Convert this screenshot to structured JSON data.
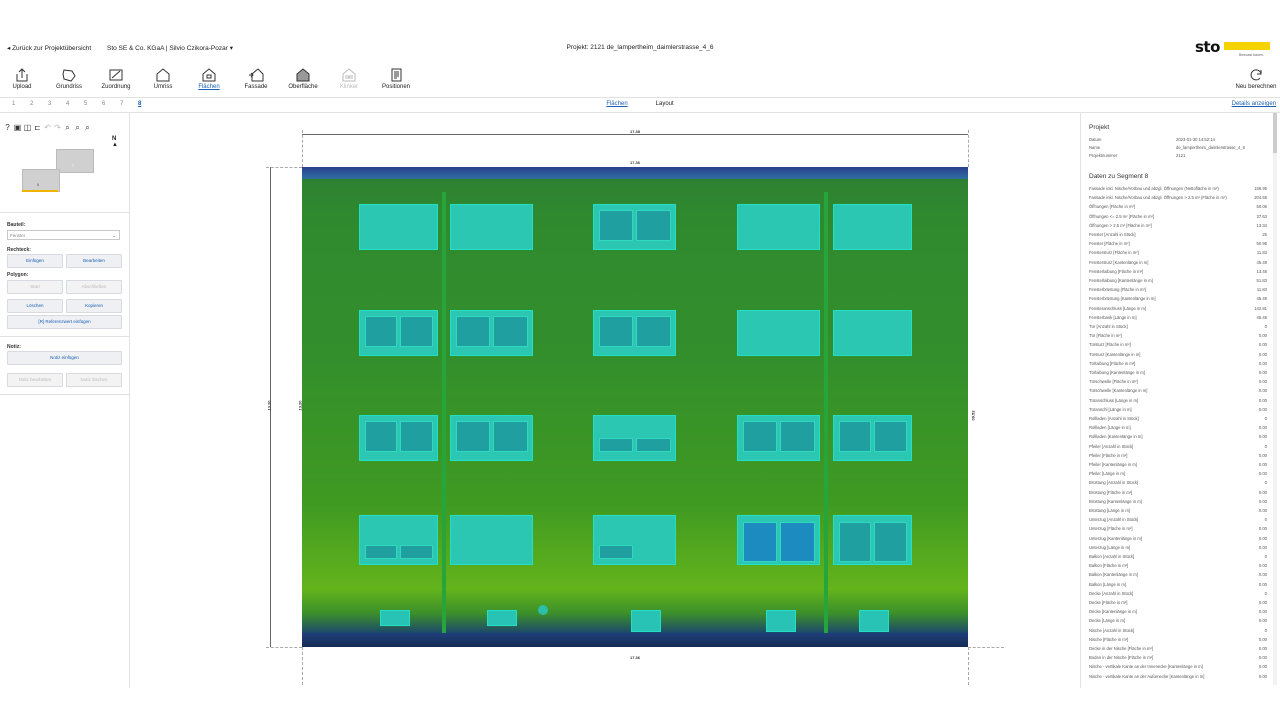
{
  "header": {
    "back_label": "Zurück zur Projektübersicht",
    "org_label": "Sto SE & Co. KGaA | Silvio Czikora-Pozar",
    "project_title": "Projekt: 2121 de_lampertheim_daimlerstrasse_4_6",
    "logo_text": "sto",
    "logo_slogan": "Bewusst bauen.",
    "brand_color": "#f5d300"
  },
  "toolbar": {
    "items": [
      {
        "label": "Upload",
        "icon": "upload-icon"
      },
      {
        "label": "Grundriss",
        "icon": "floorplan-icon"
      },
      {
        "label": "Zuordnung",
        "icon": "assign-icon"
      },
      {
        "label": "Umriss",
        "icon": "outline-icon"
      },
      {
        "label": "Flächen",
        "icon": "areas-icon"
      },
      {
        "label": "Fassade",
        "icon": "facade-icon"
      },
      {
        "label": "Oberfläche",
        "icon": "surface-icon"
      },
      {
        "label": "Klinker",
        "icon": "brick-icon"
      },
      {
        "label": "Positionen",
        "icon": "positions-icon"
      }
    ],
    "recalc_label": "Neu berechnen"
  },
  "segments": [
    "1",
    "2",
    "3",
    "4",
    "5",
    "6",
    "7",
    "8"
  ],
  "active_segment": "8",
  "tabs": [
    "Flächen",
    "Layout"
  ],
  "active_tab": "Flächen",
  "details_link": "Details anzeigen",
  "left_panel": {
    "north_label": "N",
    "minimap_labels": [
      "4",
      "5",
      "7",
      "8"
    ],
    "bauteil_label": "Bauteil:",
    "bauteil_value": "Fenster",
    "rechteck_label": "Rechteck:",
    "btn_einfuegen": "Einfügen",
    "btn_bearbeiten": "Bearbeiten",
    "polygon_label": "Polygon:",
    "btn_start": "Start",
    "btn_abschliessen": "Abschließen",
    "btn_loeschen": "Löschen",
    "btn_kopieren": "Kopieren",
    "btn_referenz": "[R] Referenzwert einfügen",
    "notiz_label": "Notiz:",
    "btn_notiz_einfuegen": "Notiz einfügen",
    "btn_notiz_bearbeiten": "Notiz bearbeiten",
    "btn_notiz_loeschen": "Notiz löschen"
  },
  "drawing": {
    "dim_top": "17.38",
    "dim_top_inner": "17.36",
    "dim_bottom": "17.36",
    "dim_left": "13.20",
    "dim_left_inner": "13.20",
    "dim_right": "09.53"
  },
  "right_panel": {
    "project_heading": "Projekt",
    "project_rows": [
      {
        "k": "Datum",
        "v": "2023-01-30 14:52:14"
      },
      {
        "k": "Name",
        "v": "de_lampertheim_daimlerstrasse_4_6"
      },
      {
        "k": "Projektnummer",
        "v": "2121"
      }
    ],
    "segment_heading": "Daten zu Segment 8",
    "data_rows": [
      {
        "k": "Fassade inkl. Nische/Vorbau und abzgl. Öffnungen (Nettofläche in m²)",
        "v": "158.95"
      },
      {
        "k": "Fassade inkl. Nische/Vorbau und abzgl. Öffnungen > 2.5 m² (Fläche in m²)",
        "v": "204.58"
      },
      {
        "k": "Öffnungen [Fläche in m²]",
        "v": "50.06"
      },
      {
        "k": "Öffnungen <= 2.5 m² [Fläche in m²]",
        "v": "37.63"
      },
      {
        "k": "Öffnungen > 2.5 m² [Fläche in m²]",
        "v": "13.34"
      },
      {
        "k": "Fenster [Anzahl in Stück]",
        "v": "25"
      },
      {
        "k": "Fenster [Fläche in m²]",
        "v": "50.96"
      },
      {
        "k": "Fenstersturz [Fläche in m²]",
        "v": "11.83"
      },
      {
        "k": "Fenstersturz [Kantenlänge in m]",
        "v": "45.49"
      },
      {
        "k": "Fensterlaibung [Fläche in m²]",
        "v": "13.48"
      },
      {
        "k": "Fensterlaibung [Kantenlänge in m]",
        "v": "51.83"
      },
      {
        "k": "Fensterbrüstung [Fläche in m²]",
        "v": "11.83"
      },
      {
        "k": "Fensterbrüstung [Kantenlänge in m]",
        "v": "45.49"
      },
      {
        "k": "Fensteranschluss [Länge in m]",
        "v": "142.81"
      },
      {
        "k": "Fensterbank [Länge in m]",
        "v": "45.49"
      },
      {
        "k": "Tür [Anzahl in Stück]",
        "v": "0"
      },
      {
        "k": "Tür [Fläche in m²]",
        "v": "0.00"
      },
      {
        "k": "Türsturz [Fläche in m²]",
        "v": "0.00"
      },
      {
        "k": "Türsturz [Kantenlänge in m]",
        "v": "0.00"
      },
      {
        "k": "Türlaibung [Fläche in m²]",
        "v": "0.00"
      },
      {
        "k": "Türlaibung [Kantenlänge in m]",
        "v": "0.00"
      },
      {
        "k": "Türschwelle [Fläche in m²]",
        "v": "0.00"
      },
      {
        "k": "Türschwelle [Kantenlänge in m]",
        "v": "0.00"
      },
      {
        "k": "Türanschluss [Länge in m]",
        "v": "0.00"
      },
      {
        "k": "Türanschl [Länge in m]",
        "v": "0.00"
      },
      {
        "k": "Rollladen [Anzahl in Stück]",
        "v": "0"
      },
      {
        "k": "Rollladen [Länge in m]",
        "v": "0.00"
      },
      {
        "k": "Rollladen [Kantenlänge in m]",
        "v": "0.00"
      },
      {
        "k": "Pfeiler [Anzahl in Stück]",
        "v": "0"
      },
      {
        "k": "Pfeiler [Fläche in m²]",
        "v": "0.00"
      },
      {
        "k": "Pfeiler [Kantenlänge in m]",
        "v": "0.00"
      },
      {
        "k": "Pfeiler [Länge in m]",
        "v": "0.00"
      },
      {
        "k": "Brüstung [Anzahl in Stück]",
        "v": "0"
      },
      {
        "k": "Brüstung [Fläche in m²]",
        "v": "0.00"
      },
      {
        "k": "Brüstung [Kantenlänge in m]",
        "v": "0.00"
      },
      {
        "k": "Brüstung [Länge in m]",
        "v": "0.00"
      },
      {
        "k": "Unterzug [Anzahl in Stück]",
        "v": "0"
      },
      {
        "k": "Unterzug [Fläche in m²]",
        "v": "0.00"
      },
      {
        "k": "Unterzug [Kantenlänge in m]",
        "v": "0.00"
      },
      {
        "k": "Unterzug [Länge in m]",
        "v": "0.00"
      },
      {
        "k": "Balkon [Anzahl in Stück]",
        "v": "0"
      },
      {
        "k": "Balkon [Fläche in m²]",
        "v": "0.00"
      },
      {
        "k": "Balkon [Kantenlänge in m]",
        "v": "0.00"
      },
      {
        "k": "Balkon [Länge in m]",
        "v": "0.00"
      },
      {
        "k": "Decke [Anzahl in Stück]",
        "v": "0"
      },
      {
        "k": "Decke [Fläche in m²]",
        "v": "0.00"
      },
      {
        "k": "Decke [Kantenlänge in m]",
        "v": "0.00"
      },
      {
        "k": "Decke [Länge in m]",
        "v": "0.00"
      },
      {
        "k": "Nische [Anzahl in Stück]",
        "v": "0"
      },
      {
        "k": "Nische [Fläche in m²]",
        "v": "0.00"
      },
      {
        "k": "Decke in der Nische [Fläche in m²]",
        "v": "0.00"
      },
      {
        "k": "Boden in der Nische [Fläche in m²]",
        "v": "0.00"
      },
      {
        "k": "Nische - vertikale Kante an der Innenecke [Kantenlänge in m]",
        "v": "0.00"
      },
      {
        "k": "Nische - vertikale Kante an der Außenecke [Kantenlänge in m]",
        "v": "0.00"
      }
    ]
  }
}
